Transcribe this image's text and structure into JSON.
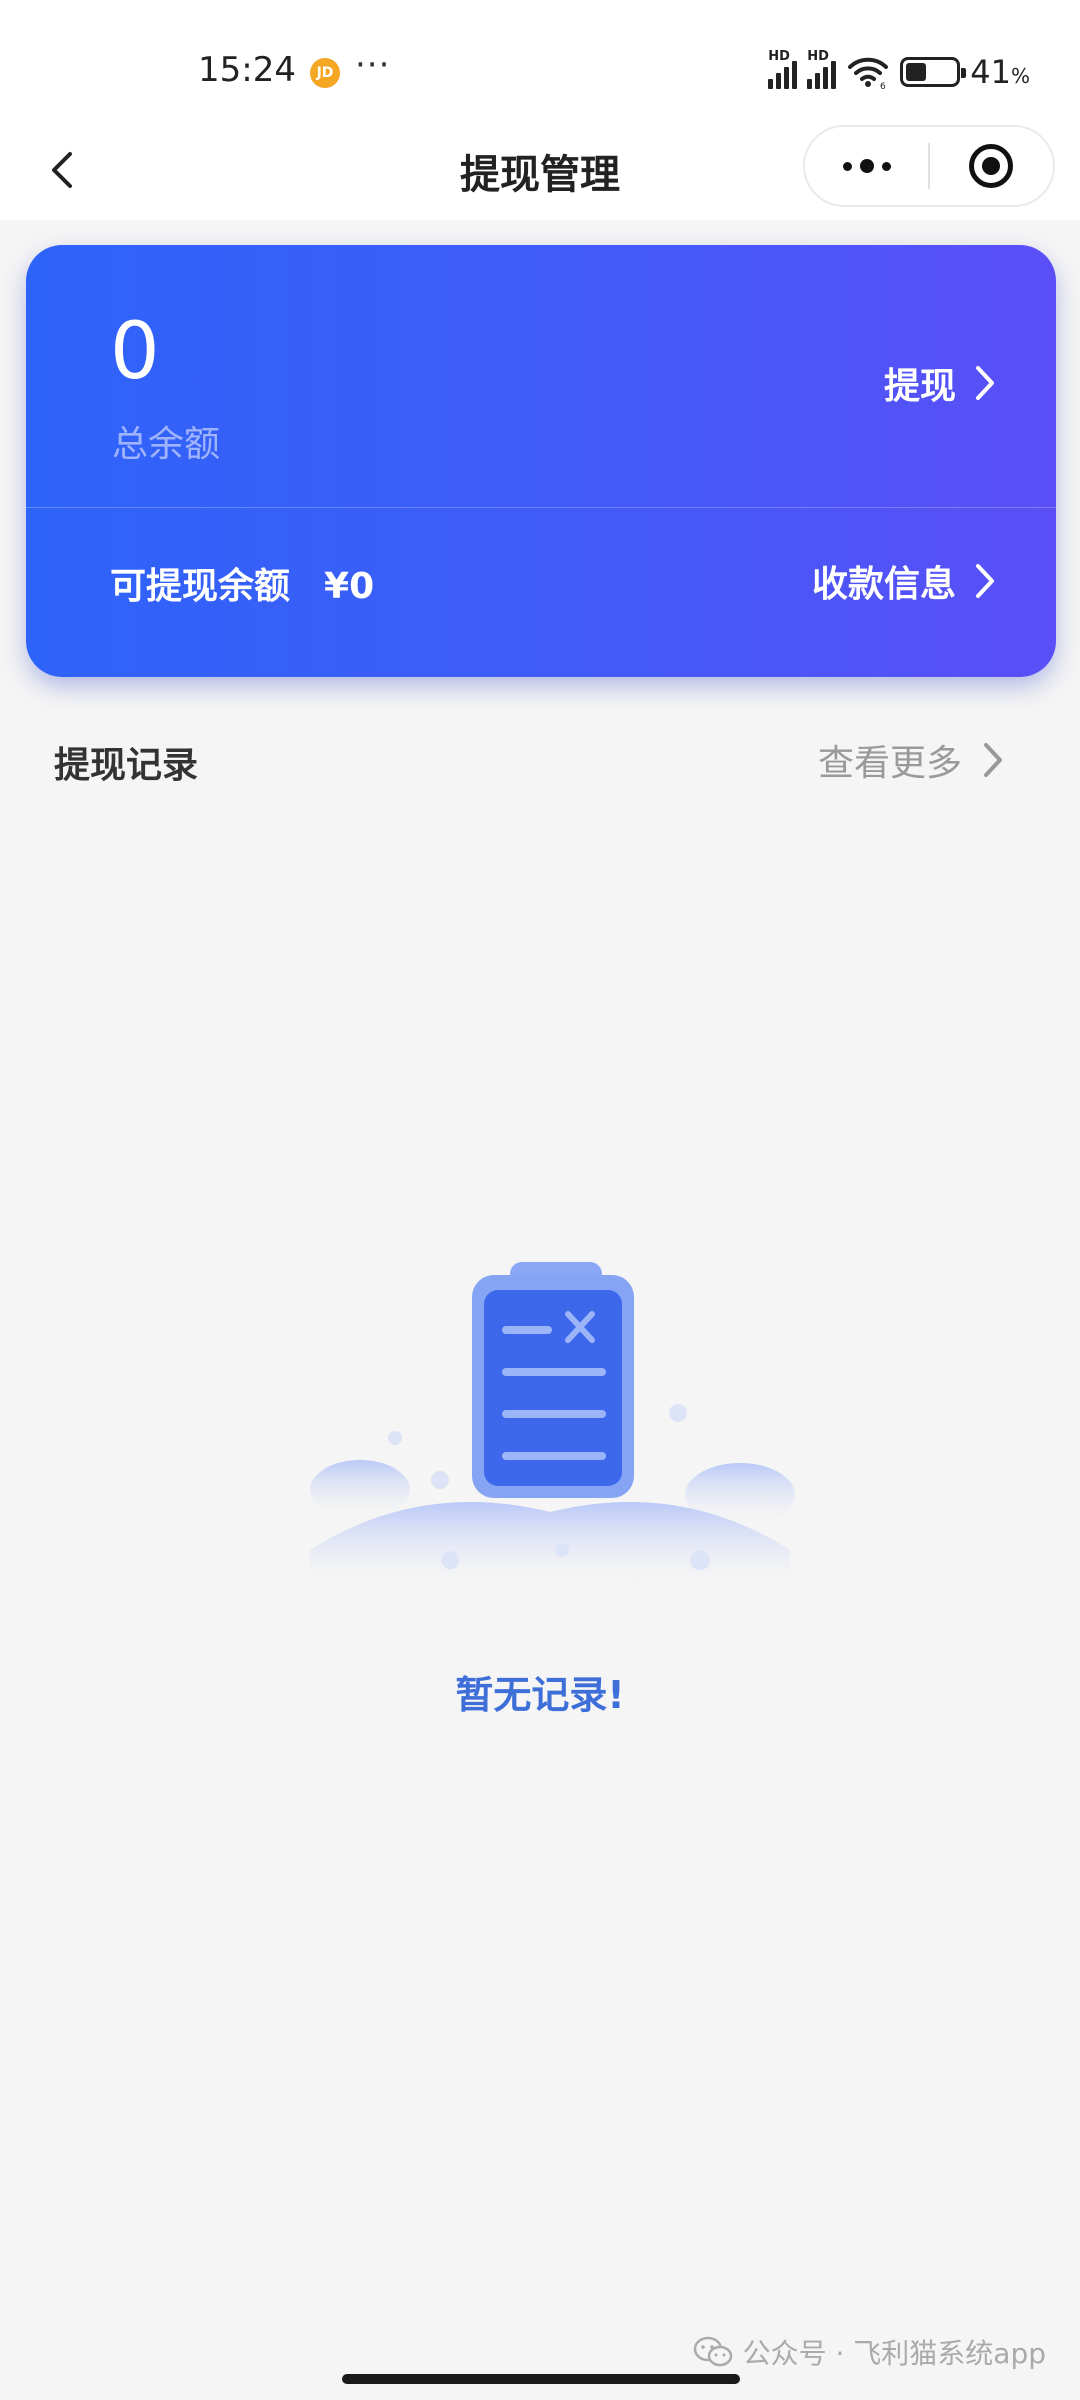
{
  "status_bar": {
    "time": "15:24",
    "notification_badge": "JD",
    "overflow": "···",
    "network_badge_1": "HD",
    "network_badge_2": "HD",
    "wifi_sub": "6",
    "battery_percent": "41",
    "battery_unit": "%",
    "battery_level": 0.41
  },
  "nav": {
    "title": "提现管理",
    "back_icon": "chevron-left-icon",
    "more_icon": "more-dots-icon",
    "close_icon": "target-icon"
  },
  "balance_card": {
    "total_amount": "0",
    "total_label": "总余额",
    "withdraw_label": "提现",
    "available_label": "可提现余额",
    "available_amount": "¥0",
    "payee_label": "收款信息",
    "colors": {
      "start": "#2e63f9",
      "end": "#5a4ff7"
    }
  },
  "records": {
    "title": "提现记录",
    "see_more_label": "查看更多",
    "empty_text": "暂无记录!",
    "empty_icon": "clipboard-x-icon"
  },
  "watermark": {
    "icon": "wechat-icon",
    "text": "公众号 · 飞利猫系统app"
  }
}
